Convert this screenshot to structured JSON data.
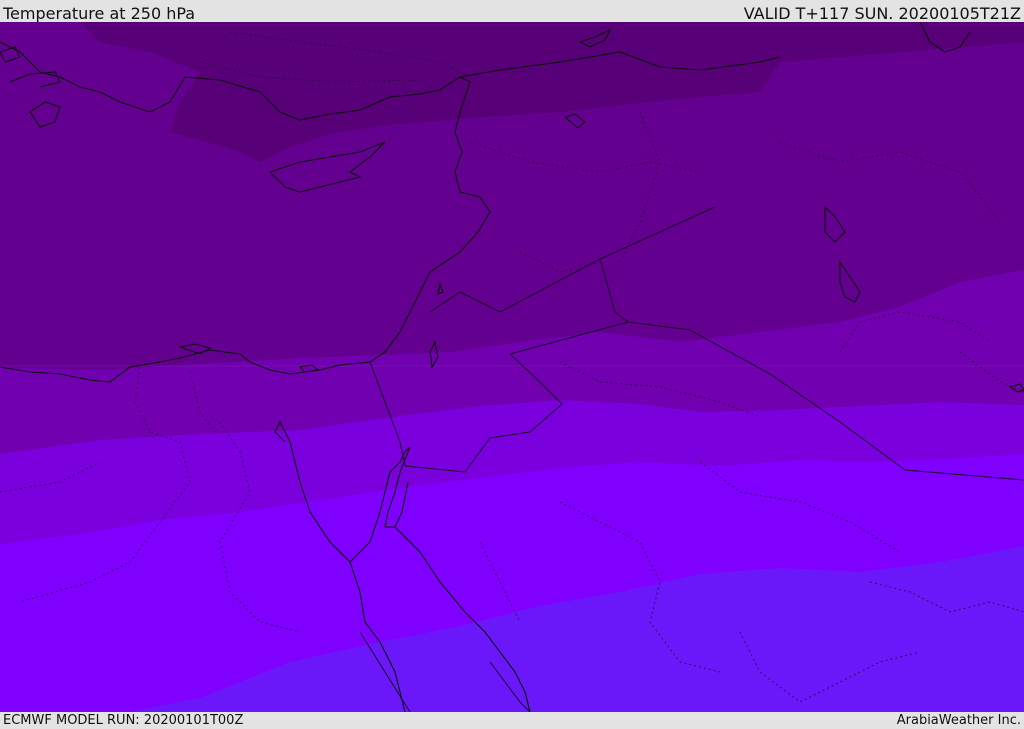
{
  "header": {
    "title": "Temperature at 250 hPa",
    "valid": "VALID T+117 SUN. 20200105T21Z"
  },
  "footer": {
    "model_run": "ECMWF MODEL RUN: 20200101T00Z",
    "credit": "ArabiaWeather Inc."
  },
  "map": {
    "parameter": "Temperature",
    "level_hPa": 250,
    "region": "Eastern Mediterranean / Middle East",
    "colors": {
      "band_coldest": "#570078",
      "band_2": "#640090",
      "band_3": "#7000b0",
      "band_4": "#7a00dd",
      "band_5": "#8000ff",
      "band_6": "#6a18fa",
      "coastline": "#111111",
      "border": "#222222"
    }
  }
}
